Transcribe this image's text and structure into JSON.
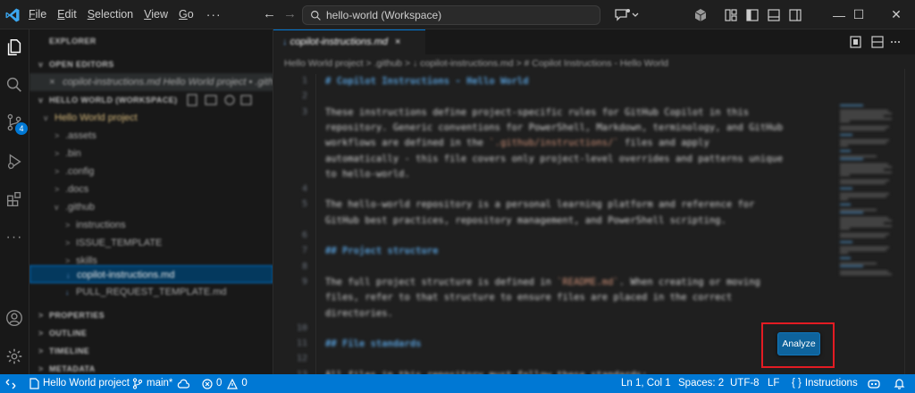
{
  "titlebar": {
    "menu": [
      {
        "label": "File",
        "underline": "F"
      },
      {
        "label": "Edit",
        "underline": "E"
      },
      {
        "label": "Selection",
        "underline": "S"
      },
      {
        "label": "View",
        "underline": "V"
      },
      {
        "label": "Go",
        "underline": "G"
      }
    ],
    "more": "···",
    "search_text": "hello-world (Workspace)",
    "window_buttons": [
      "—",
      "☐",
      "✕"
    ]
  },
  "activity_bar": {
    "items": [
      "explorer-icon",
      "search-icon",
      "source-control-icon",
      "run-debug-icon",
      "extensions-icon",
      "more-icon",
      "accounts-icon",
      "settings-icon"
    ],
    "source_control_badge": "4",
    "more_glyph": "···"
  },
  "sidebar": {
    "header": "EXPLORER",
    "open_editors": "OPEN EDITORS",
    "open_file": "copilot-instructions.md  Hello World project • .github",
    "workspace": "HELLO WORLD (WORKSPACE)",
    "tree": [
      {
        "label": "Hello World project",
        "indent": 1,
        "chev": "v",
        "type": "folder-root"
      },
      {
        "label": ".assets",
        "indent": 2,
        "chev": ">"
      },
      {
        "label": ".bin",
        "indent": 2,
        "chev": ">"
      },
      {
        "label": ".config",
        "indent": 2,
        "chev": ">"
      },
      {
        "label": ".docs",
        "indent": 2,
        "chev": ">"
      },
      {
        "label": ".github",
        "indent": 2,
        "chev": "v"
      },
      {
        "label": "instructions",
        "indent": 3,
        "chev": ">"
      },
      {
        "label": "ISSUE_TEMPLATE",
        "indent": 3,
        "chev": ">"
      },
      {
        "label": "skills",
        "indent": 3,
        "chev": ">"
      },
      {
        "label": "copilot-instructions.md",
        "indent": 3,
        "chev": "",
        "selected": true
      },
      {
        "label": "PULL_REQUEST_TEMPLATE.md",
        "indent": 3,
        "chev": ""
      }
    ],
    "sections": [
      "PROPERTIES",
      "OUTLINE",
      "TIMELINE",
      "METADATA"
    ]
  },
  "editor": {
    "tab_label": "copilot-instructions.md",
    "breadcrumb": "Hello World project  >  .github  >  ↓  copilot-instructions.md  >  # Copilot Instructions - Hello World",
    "lines": [
      {
        "n": "1",
        "text": "# Copilot Instructions - Hello World",
        "kind": "heading"
      },
      {
        "n": "2",
        "text": "",
        "kind": "text"
      },
      {
        "n": "3",
        "text": "These instructions define project-specific rules for GitHub Copilot in this",
        "kind": "text"
      },
      {
        "n": "",
        "text": "repository. Generic conventions for PowerShell, Markdown, terminology, and GitHub",
        "kind": "text"
      },
      {
        "n": "",
        "text": "workflows are defined in the `.github/instructions/` files and apply",
        "kind": "text"
      },
      {
        "n": "",
        "text": "automatically - this file covers only project-level overrides and patterns unique",
        "kind": "text"
      },
      {
        "n": "",
        "text": "to hello-world.",
        "kind": "text"
      },
      {
        "n": "4",
        "text": "",
        "kind": "text"
      },
      {
        "n": "5",
        "text": "The hello-world repository is a personal learning platform and reference for",
        "kind": "text"
      },
      {
        "n": "",
        "text": "GitHub best practices, repository management, and PowerShell scripting.",
        "kind": "text"
      },
      {
        "n": "6",
        "text": "",
        "kind": "text"
      },
      {
        "n": "7",
        "text": "## Project structure",
        "kind": "heading"
      },
      {
        "n": "8",
        "text": "",
        "kind": "text"
      },
      {
        "n": "9",
        "text": "The full project structure is defined in `README.md`. When creating or moving",
        "kind": "text"
      },
      {
        "n": "",
        "text": "files, refer to that structure to ensure files are placed in the correct",
        "kind": "text"
      },
      {
        "n": "",
        "text": "directories.",
        "kind": "text"
      },
      {
        "n": "10",
        "text": "",
        "kind": "text"
      },
      {
        "n": "11",
        "text": "## File standards",
        "kind": "heading"
      },
      {
        "n": "12",
        "text": "",
        "kind": "text"
      },
      {
        "n": "13",
        "text": "All files in this repository must follow these standards:",
        "kind": "text"
      }
    ],
    "analyze_label": "Analyze"
  },
  "statusbar": {
    "remote": "",
    "project": "Hello World project",
    "branch": "main*",
    "errors": "0",
    "warnings": "0",
    "position": "Ln 1, Col 1",
    "spaces": "Spaces: 2",
    "encoding": "UTF-8",
    "eol": "LF",
    "language": "Instructions",
    "language_prefix": "{ }"
  },
  "colors": {
    "accent": "#0078d4",
    "highlight_box": "#e31b23",
    "analyze_button": "#0e639c"
  }
}
